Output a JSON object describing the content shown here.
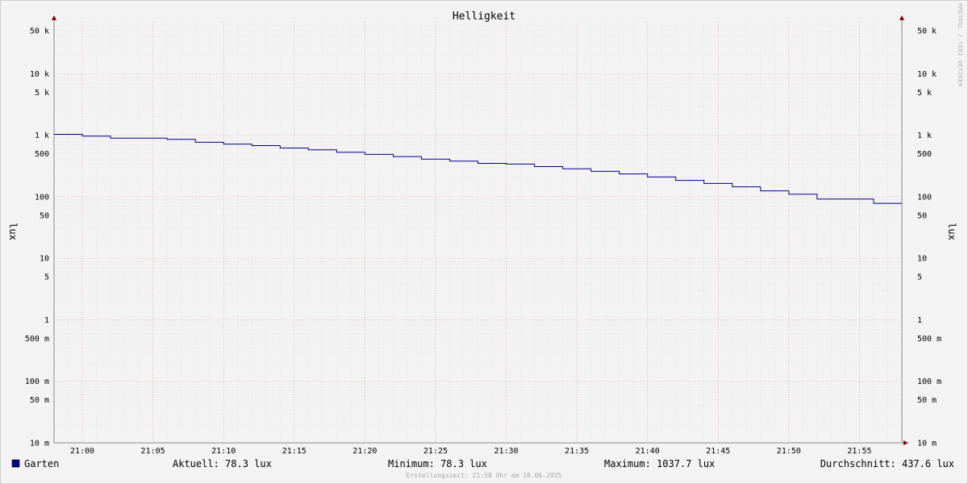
{
  "chart_data": {
    "type": "line",
    "title": "Helligkeit",
    "ylabel": "lux",
    "y_scale": "log",
    "ylim": [
      0.01,
      70000
    ],
    "y_ticks": [
      {
        "value": 50000,
        "label": "50 k"
      },
      {
        "value": 10000,
        "label": "10 k"
      },
      {
        "value": 5000,
        "label": "5 k"
      },
      {
        "value": 1000,
        "label": "1 k"
      },
      {
        "value": 500,
        "label": "500"
      },
      {
        "value": 100,
        "label": "100"
      },
      {
        "value": 50,
        "label": "50"
      },
      {
        "value": 10,
        "label": "10"
      },
      {
        "value": 5,
        "label": "5"
      },
      {
        "value": 1,
        "label": "1"
      },
      {
        "value": 0.5,
        "label": "500 m"
      },
      {
        "value": 0.1,
        "label": "100 m"
      },
      {
        "value": 0.05,
        "label": "50 m"
      },
      {
        "value": 0.01,
        "label": "10 m"
      }
    ],
    "xlim": [
      "20:58",
      "21:58"
    ],
    "x_ticks": [
      "21:00",
      "21:05",
      "21:10",
      "21:15",
      "21:20",
      "21:25",
      "21:30",
      "21:35",
      "21:40",
      "21:45",
      "21:50",
      "21:55"
    ],
    "grid": true,
    "series": [
      {
        "name": "Garten",
        "color": "#000088",
        "x": [
          "20:58",
          "21:00",
          "21:02",
          "21:06",
          "21:08",
          "21:10",
          "21:12",
          "21:14",
          "21:16",
          "21:18",
          "21:20",
          "21:22",
          "21:24",
          "21:26",
          "21:28",
          "21:30",
          "21:32",
          "21:34",
          "21:36",
          "21:38",
          "21:40",
          "21:42",
          "21:44",
          "21:46",
          "21:48",
          "21:50",
          "21:52",
          "21:56",
          "21:58"
        ],
        "values": [
          1037.7,
          970,
          900,
          860,
          770,
          720,
          680,
          620,
          580,
          530,
          490,
          450,
          410,
          380,
          350,
          340,
          310,
          285,
          260,
          235,
          210,
          185,
          165,
          145,
          125,
          110,
          92,
          78.3,
          78.3
        ]
      }
    ],
    "legend": {
      "series_name": "Garten",
      "swatch_color": "#000088",
      "current": "Aktuell:  78.3 lux",
      "minimum": "Minimum:  78.3 lux",
      "maximum": "Maximum: 1037.7 lux",
      "average": "Durchschnitt: 437.6 lux"
    },
    "watermark": "RRDTOOL / TOBI OETIKER",
    "footer": "Erstellungszeit: 21:58 Uhr am 18.06.2025"
  }
}
